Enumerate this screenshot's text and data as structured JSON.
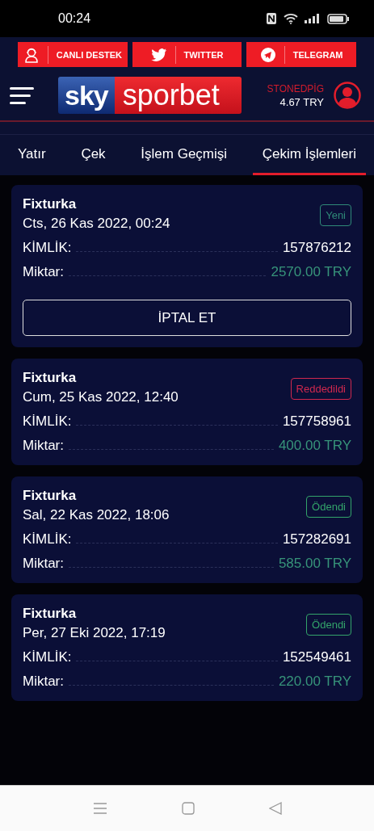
{
  "status_bar": {
    "time": "00:24"
  },
  "top_links": [
    {
      "kind": "support",
      "label": "CANLI DESTEK"
    },
    {
      "kind": "twitter",
      "label": "TWITTER"
    },
    {
      "kind": "telegram",
      "label": "TELEGRAM"
    }
  ],
  "header": {
    "logo": {
      "part_1": "sky",
      "part_2": "sporbet"
    },
    "username": "STONEDPİG",
    "balance": "4.67 TRY"
  },
  "tabs": [
    {
      "label": "Yatır",
      "selected": false
    },
    {
      "label": "Çek",
      "selected": false
    },
    {
      "label": "İşlem Geçmişi",
      "selected": false
    },
    {
      "label": "Çekim İşlemleri",
      "selected": true
    }
  ],
  "withdrawals": [
    {
      "method": "Fixturka",
      "date": "Cts, 26 Kas 2022, 00:24",
      "status": {
        "label": "Yeni",
        "color": "#2f8a78"
      },
      "id_label": "KİMLİK:",
      "id": "157876212",
      "amount_label": "Miktar:",
      "amount": "2570.00 TRY",
      "cancel_button": "İPTAL ET"
    },
    {
      "method": "Fixturka",
      "date": "Cum, 25 Kas 2022, 12:40",
      "status": {
        "label": "Reddedildi",
        "color": "#d0284e"
      },
      "id_label": "KİMLİK:",
      "id": "157758961",
      "amount_label": "Miktar:",
      "amount": "400.00 TRY"
    },
    {
      "method": "Fixturka",
      "date": "Sal, 22 Kas 2022, 18:06",
      "status": {
        "label": "Ödendi",
        "color": "#33a46a"
      },
      "id_label": "KİMLİK:",
      "id": "157282691",
      "amount_label": "Miktar:",
      "amount": "585.00 TRY"
    },
    {
      "method": "Fixturka",
      "date": "Per, 27 Eki 2022, 17:19",
      "status": {
        "label": "Ödendi",
        "color": "#33a46a"
      },
      "id_label": "KİMLİK:",
      "id": "152549461",
      "amount_label": "Miktar:",
      "amount": "220.00 TRY"
    }
  ]
}
